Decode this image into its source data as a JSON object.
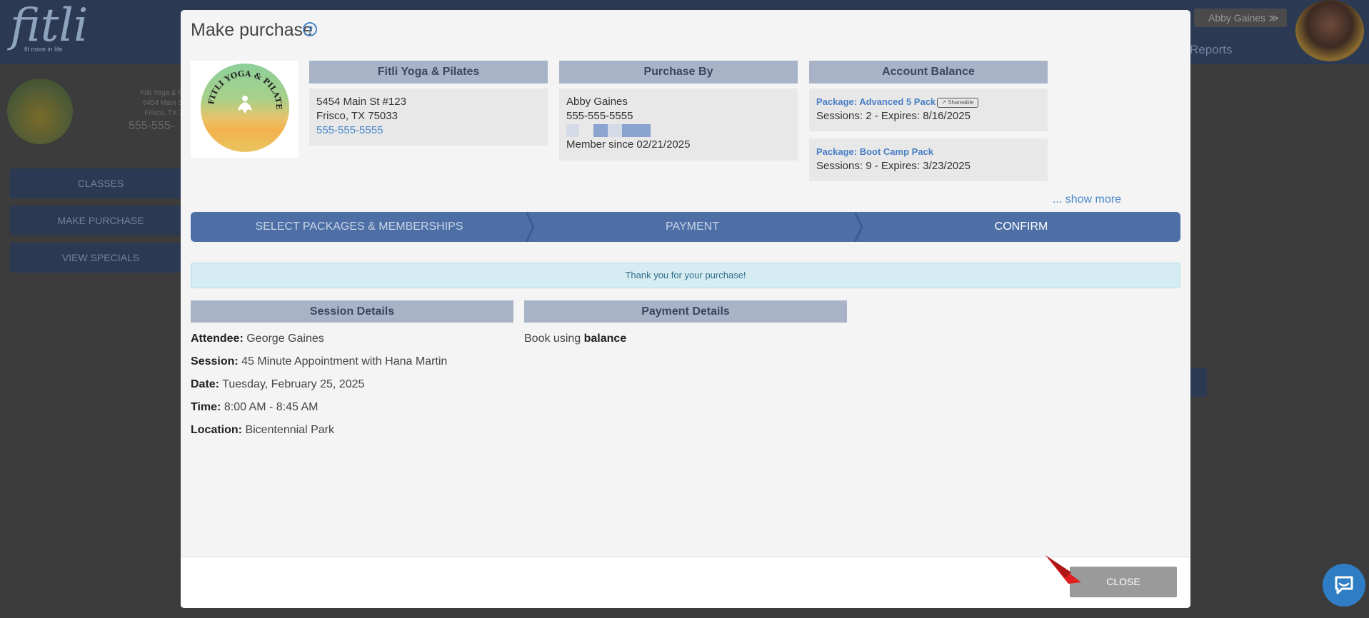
{
  "background": {
    "logo": "fitli",
    "logo_tagline": "fit more in life",
    "user_menu": "Abby Gaines",
    "reports_label": "Reports",
    "studio_address_1": "Fitli Yoga & P",
    "studio_address_2": "5454 Main S",
    "studio_address_3": "Frisco, TX 7",
    "studio_phone": "555-555-",
    "buttons": [
      "CLASSES",
      "MAKE PURCHASE",
      "VIEW SPECIALS"
    ]
  },
  "modal": {
    "title": "Make purchase",
    "help_symbol": "?",
    "studio": {
      "header": "Fitli Yoga & Pilates",
      "address_line1": "5454 Main St #123",
      "address_line2": "Frisco, TX 75033",
      "phone": "555-555-5555",
      "logo_text": "FITLI YOGA & PILATES"
    },
    "purchase_by": {
      "header": "Purchase By",
      "name": "Abby Gaines",
      "phone": "555-555-5555",
      "member_since": "Member since 02/21/2025"
    },
    "account_balance": {
      "header": "Account Balance",
      "packages": [
        {
          "name": "Package: Advanced 5 Pack",
          "badge": "Shareable",
          "details": "Sessions: 2 -  Expires: 8/16/2025"
        },
        {
          "name": "Package: Boot Camp Pack",
          "details": "Sessions: 9 -  Expires: 3/23/2025"
        }
      ],
      "show_more": "... show more"
    },
    "steps": [
      "SELECT PACKAGES & MEMBERSHIPS",
      "PAYMENT",
      "CONFIRM"
    ],
    "active_step": "CONFIRM",
    "alert": "Thank you for your purchase!",
    "session_details": {
      "header": "Session Details",
      "attendee_label": "Attendee:",
      "attendee": "George Gaines",
      "session_label": "Session:",
      "session": "45 Minute Appointment with Hana Martin",
      "date_label": "Date:",
      "date": "Tuesday, February 25, 2025",
      "time_label": "Time:",
      "time": "8:00 AM - 8:45 AM",
      "location_label": "Location:",
      "location": "Bicentennial Park"
    },
    "payment_details": {
      "header": "Payment Details",
      "text": "Book using",
      "method": "balance"
    },
    "close_label": "CLOSE"
  },
  "colors": {
    "accent": "#4d6fa6",
    "section_header": "#a9b3c7",
    "link": "#4a88c9",
    "alert_bg": "#d6ecf3",
    "arrow": "#e02020"
  }
}
